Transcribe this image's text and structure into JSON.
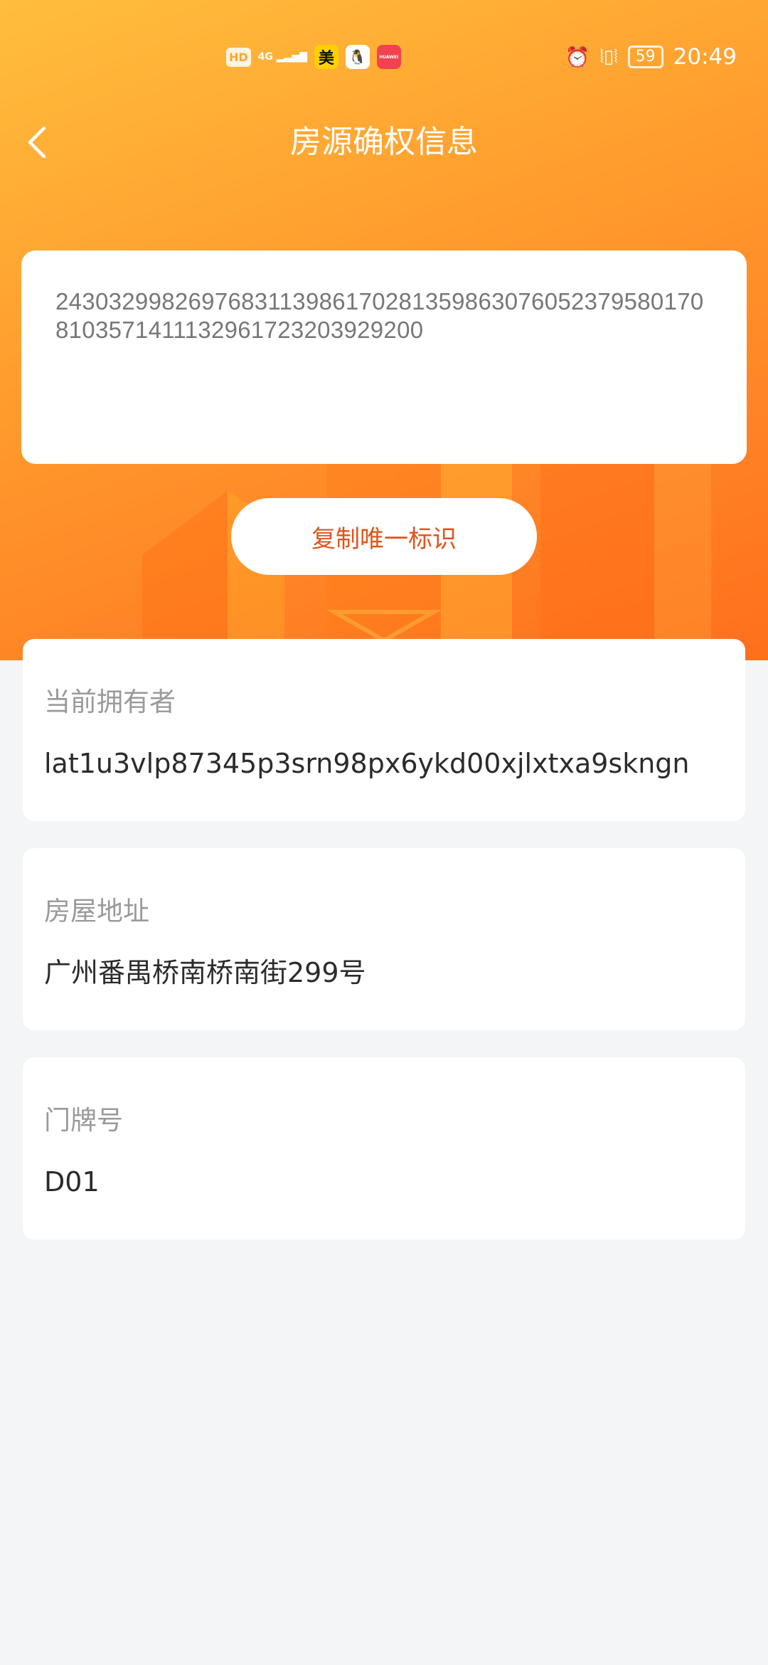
{
  "status_bar": {
    "hd": "HD",
    "network": "4G",
    "apps": [
      "美",
      "QQ",
      "HUAWEI"
    ],
    "battery": "59",
    "time": "20:49"
  },
  "header": {
    "title": "房源确权信息"
  },
  "identifier": {
    "value": "243032998269768311398617028135986307605237958017081035714111329617232039292 00"
  },
  "copy_button": {
    "label": "复制唯一标识"
  },
  "fields": [
    {
      "label": "当前拥有者",
      "value": "lat1u3vlp87345p3srn98px6ykd00xjlxtxa9skngn"
    },
    {
      "label": "房屋地址",
      "value": "广州番禺桥南桥南街299号"
    },
    {
      "label": "门牌号",
      "value": "D01"
    }
  ],
  "colors": {
    "accent": "#ff8a28",
    "button_text": "#e2541c",
    "background": "#f4f5f7"
  }
}
